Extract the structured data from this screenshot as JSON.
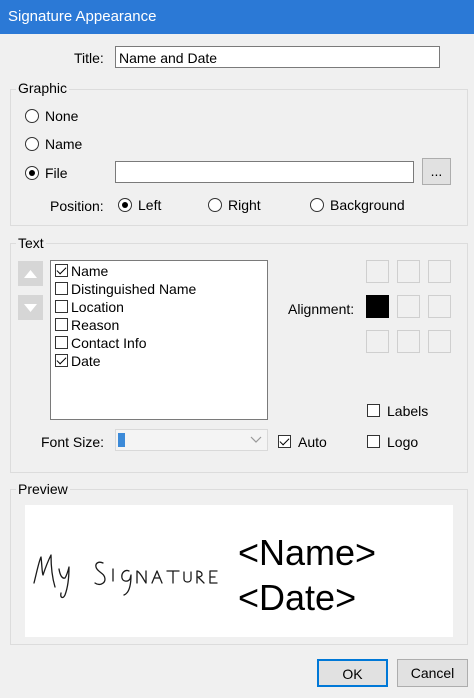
{
  "window": {
    "title": "Signature Appearance"
  },
  "title_field": {
    "label": "Title:",
    "value": "Name and Date"
  },
  "graphic": {
    "group_label": "Graphic",
    "options": [
      {
        "label": "None",
        "selected": false
      },
      {
        "label": "Name",
        "selected": false
      },
      {
        "label": "File",
        "selected": true
      }
    ],
    "file_path": "",
    "browse_label": "...",
    "position_label": "Position:",
    "positions": [
      {
        "label": "Left",
        "selected": true
      },
      {
        "label": "Right",
        "selected": false
      },
      {
        "label": "Background",
        "selected": false
      }
    ]
  },
  "text": {
    "group_label": "Text",
    "items": [
      {
        "label": "Name",
        "checked": true
      },
      {
        "label": "Distinguished Name",
        "checked": false
      },
      {
        "label": "Location",
        "checked": false
      },
      {
        "label": "Reason",
        "checked": false
      },
      {
        "label": "Contact Info",
        "checked": false
      },
      {
        "label": "Date",
        "checked": true
      }
    ],
    "alignment_label": "Alignment:",
    "alignment_selected": 3,
    "labels_option": {
      "label": "Labels",
      "checked": false
    },
    "logo_option": {
      "label": "Logo",
      "checked": false
    },
    "font_size_label": "Font Size:",
    "font_size_value": "",
    "auto_option": {
      "label": "Auto",
      "checked": true
    }
  },
  "preview": {
    "group_label": "Preview",
    "signature_text": "My Signature",
    "line1": "<Name>",
    "line2": "<Date>"
  },
  "buttons": {
    "ok": "OK",
    "cancel": "Cancel"
  },
  "colors": {
    "titlebar": "#2b79d6",
    "accent": "#0078d7"
  }
}
